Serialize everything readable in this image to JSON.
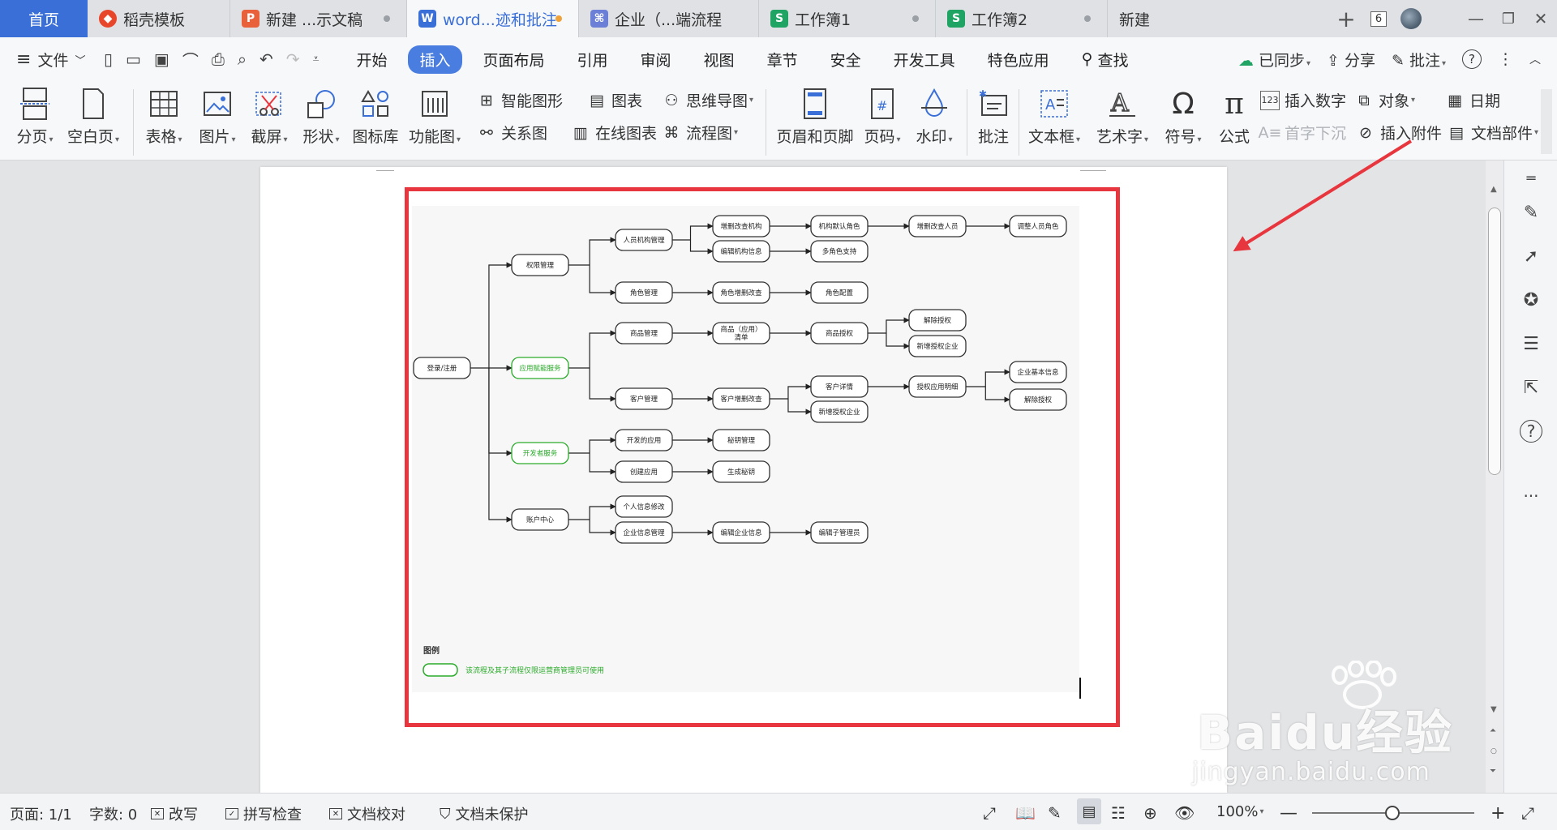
{
  "tabs": [
    {
      "label": "首页",
      "type": "home"
    },
    {
      "label": "稻壳模板",
      "icon": "docer-icon",
      "color": "#e8462b"
    },
    {
      "label": "新建 ...示文稿",
      "icon": "presentation-icon",
      "color": "#e8613a"
    },
    {
      "label": "word...迹和批注",
      "icon": "word-icon",
      "color": "#3a6fd8",
      "active": true
    },
    {
      "label": "企业（...端流程",
      "icon": "flowchart-icon",
      "color": "#6b7fd7"
    },
    {
      "label": "工作簿1",
      "icon": "spreadsheet-icon",
      "color": "#1fa463"
    },
    {
      "label": "工作簿2",
      "icon": "spreadsheet-icon",
      "color": "#1fa463"
    },
    {
      "label": "新建"
    }
  ],
  "window": {
    "count": "6"
  },
  "menu": {
    "file_label": "文件",
    "items": [
      "开始",
      "插入",
      "页面布局",
      "引用",
      "审阅",
      "视图",
      "章节",
      "安全",
      "开发工具",
      "特色应用"
    ],
    "active": "插入",
    "search": "查找",
    "sync": "已同步",
    "share": "分享",
    "comment": "批注"
  },
  "ribbon": {
    "page_break": "分页",
    "blank_page": "空白页",
    "table": "表格",
    "picture": "图片",
    "screenshot": "截屏",
    "shape": "形状",
    "icon_lib": "图标库",
    "func_chart": "功能图",
    "smart_graphic": "智能图形",
    "chart": "图表",
    "relation": "关系图",
    "online_chart": "在线图表",
    "mindmap": "思维导图",
    "flowchart": "流程图",
    "header_footer": "页眉和页脚",
    "page_number": "页码",
    "watermark": "水印",
    "comment": "批注",
    "textbox": "文本框",
    "wordart": "艺术字",
    "symbol": "符号",
    "formula": "公式",
    "insert_number": "插入数字",
    "object": "对象",
    "date": "日期",
    "dropcap": "首字下沉",
    "attachment": "插入附件",
    "doc_parts": "文档部件"
  },
  "flowchart": {
    "nodes": {
      "login": "登录/注册",
      "perm": "权限管理",
      "app": "应用赋能服务",
      "dev": "开发者服务",
      "account": "账户中心",
      "org_mgmt": "人员机构管理",
      "role_mgmt": "角色管理",
      "product_mgmt": "商品管理",
      "customer_mgmt": "客户管理",
      "developed_app": "开发的应用",
      "create_app": "创建应用",
      "personal_info": "个人信息修改",
      "company_info": "企业信息管理",
      "org_crud": "增删改查机构",
      "org_edit": "编辑机构信息",
      "role_crud": "角色增删改查",
      "product_list": "商品（应用）\n清单",
      "customer_crud": "客户增删改查",
      "secret_mgmt": "秘钥管理",
      "gen_secret": "生成秘钥",
      "edit_company": "编辑企业信息",
      "org_default_role": "机构默认角色",
      "multi_role": "多角色支持",
      "role_config": "角色配置",
      "product_auth": "商品授权",
      "customer_detail": "客户详情",
      "new_auth_company2": "新增授权企业",
      "edit_sub_admin": "编辑子管理员",
      "person_crud": "增删改查人员",
      "revoke_auth1": "解除授权",
      "new_auth_company1": "新增授权企业",
      "auth_app_detail": "授权应用明细",
      "adjust_person_role": "调整人员角色",
      "company_basic": "企业基本信息",
      "revoke_auth2": "解除授权"
    },
    "legend_title": "图例",
    "legend_text": "该流程及其子流程仅限运营商管理员可使用",
    "green": "#2bab2b"
  },
  "statusbar": {
    "page": "页面: 1/1",
    "words": "字数: 0",
    "overwrite": "改写",
    "spellcheck": "拼写检查",
    "proofread": "文档校对",
    "protect": "文档未保护",
    "zoom": "100%"
  },
  "annotation_color": "#e8363f",
  "watermark": {
    "main": "Baidu经验",
    "sub": "jingyan.baidu.com"
  }
}
